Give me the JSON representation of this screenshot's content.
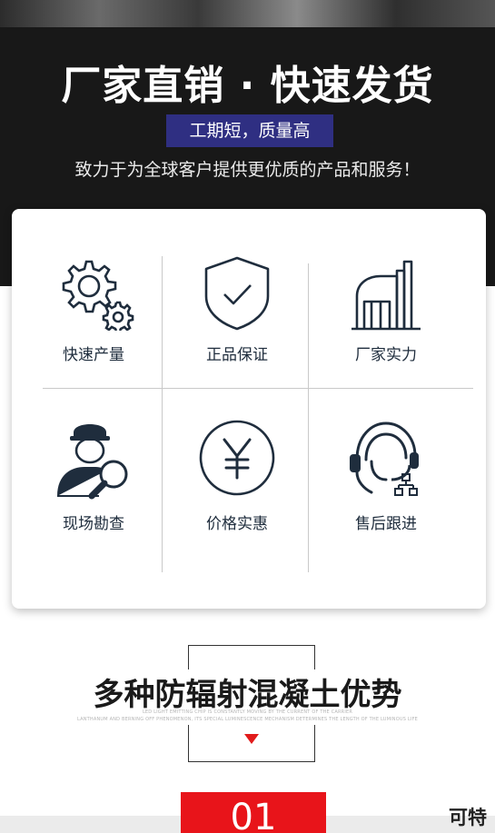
{
  "hero": {
    "headline": "厂家直销 · 快速发货",
    "badge": "工期短，质量高",
    "tagline": "致力于为全球客户提供更优质的产品和服务！"
  },
  "features": [
    {
      "label": "快速产量",
      "icon": "gears-icon"
    },
    {
      "label": "正品保证",
      "icon": "shield-check-icon"
    },
    {
      "label": "厂家实力",
      "icon": "factory-icon"
    },
    {
      "label": "现场勘查",
      "icon": "inspector-magnifier-icon"
    },
    {
      "label": "价格实惠",
      "icon": "yen-coin-icon"
    },
    {
      "label": "售后跟进",
      "icon": "headset-support-icon"
    }
  ],
  "section": {
    "title": "多种防辐射混凝土优势",
    "subtext_line1": "LED LIGHT EMITTING CHIP IS CONSTANTLY MOVING BY THE CURRENT OF THE CARRIER",
    "subtext_line2": "LANTHANUM AND BERNING OFF PHENOMENON, ITS SPECIAL LUMINESCENCE MECHANISM DETERMINES THE LENGTH OF THE LUMINOUS LIFE",
    "number": "01",
    "edge_text": "可特"
  },
  "colors": {
    "dark_band": "#181818",
    "badge": "#2f2f82",
    "icon": "#1f2d3d",
    "accent_red": "#e8141a"
  }
}
